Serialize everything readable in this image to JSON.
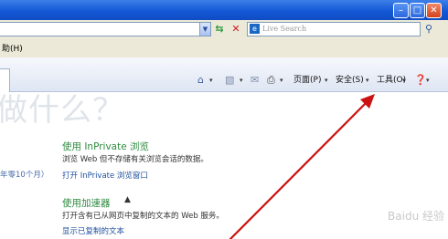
{
  "address_bar": {
    "live_search_placeholder": "Live Search",
    "live_logo": "e"
  },
  "menu_fragment": "助(H)",
  "command_bar": {
    "page_label": "页面(P)",
    "safety_label": "安全(S)",
    "tools_label": "工具(O)"
  },
  "content": {
    "background_heading": "做什么？",
    "left_fragment": "年零10个月）",
    "inprivate": {
      "title": "使用 InPrivate 浏览",
      "description": "浏览 Web 但不存储有关浏览会话的数据。",
      "link": "打开 InPrivate 浏览窗口"
    },
    "accelerators": {
      "title": "使用加速器",
      "description": "打开含有已从网页中复制的文本的 Web 服务。",
      "link": "显示已复制的文本"
    }
  },
  "watermark": "Baidu 经验",
  "colors": {
    "annotation_arrow": "#cc1111",
    "section_title": "#2d8a3e",
    "link": "#1f4f9c"
  }
}
